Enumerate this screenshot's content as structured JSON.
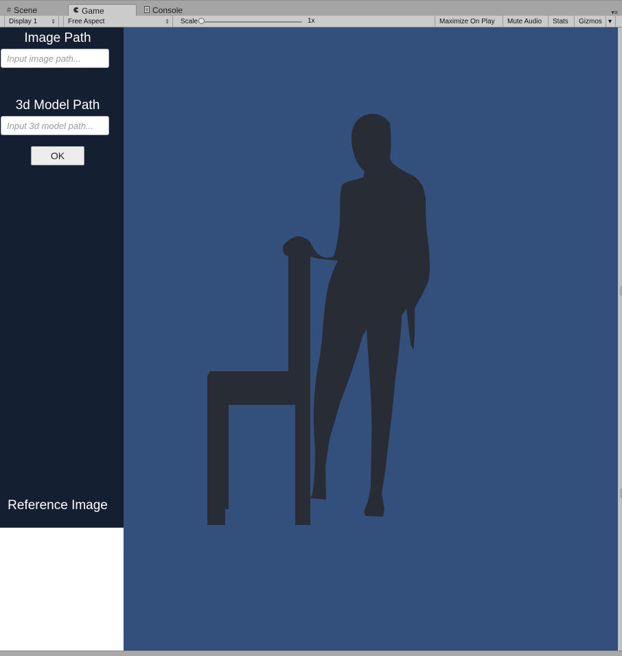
{
  "tabs": {
    "scene": "Scene",
    "game": "Game",
    "console": "Console"
  },
  "toolbar": {
    "display": "Display 1",
    "aspect": "Free Aspect",
    "scale_label": "Scale",
    "scale_value": "1x",
    "scale_slider_level": 0.0,
    "maximize_on_play": "Maximize On Play",
    "mute_audio": "Mute Audio",
    "stats": "Stats",
    "gizmos": "Gizmos"
  },
  "panel": {
    "image_path_label": "Image Path",
    "image_path_placeholder": "Input image path...",
    "image_path_value": "",
    "model_path_label": "3d Model Path",
    "model_path_placeholder": "Input 3d model path...",
    "model_path_value": "",
    "ok_button": "OK",
    "reference_image_label": "Reference Image"
  },
  "colors": {
    "game_background": "#33507d",
    "panel_background": "#141f31",
    "silhouette": "#272c35",
    "reference_image_fill": "#ffffff"
  },
  "icons": {
    "scene_tab": "grid-icon",
    "game_tab": "pacman-icon",
    "console_tab": "console-icon",
    "tab_menu": "dropdown-menu-icon"
  }
}
